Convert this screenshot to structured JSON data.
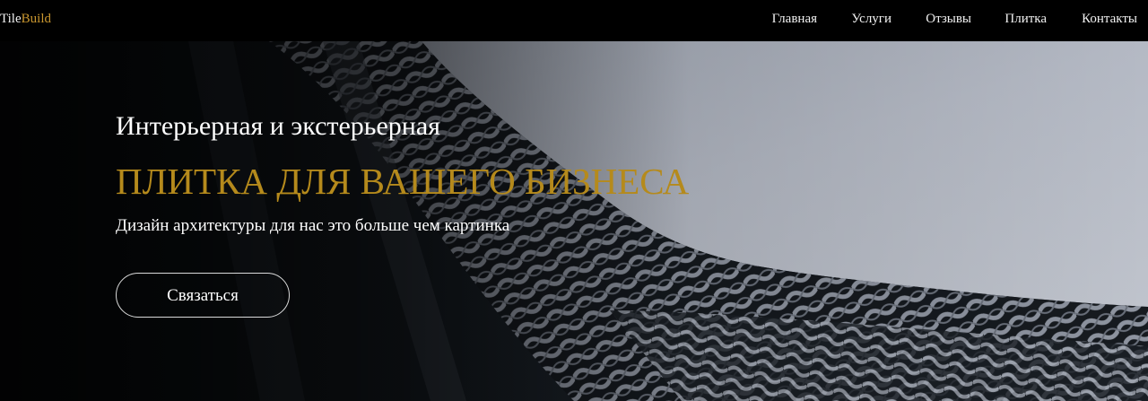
{
  "brand": {
    "name_part1": "Tile",
    "name_part2": "Build",
    "accent_color": "#c9962f"
  },
  "nav": {
    "items": [
      {
        "label": "Главная"
      },
      {
        "label": "Услуги"
      },
      {
        "label": "Отзывы"
      },
      {
        "label": "Плитка"
      },
      {
        "label": "Контакты"
      }
    ]
  },
  "hero": {
    "headline": "Интерьерная и экстерьерная",
    "accent_headline": "ПЛИТКА ДЛЯ ВАШЕГО БИЗНЕСА",
    "subtitle": "Дизайн архитектуры для нас это больше чем картинка",
    "cta_label": "Связаться",
    "accent_color": "#b58a1c"
  }
}
